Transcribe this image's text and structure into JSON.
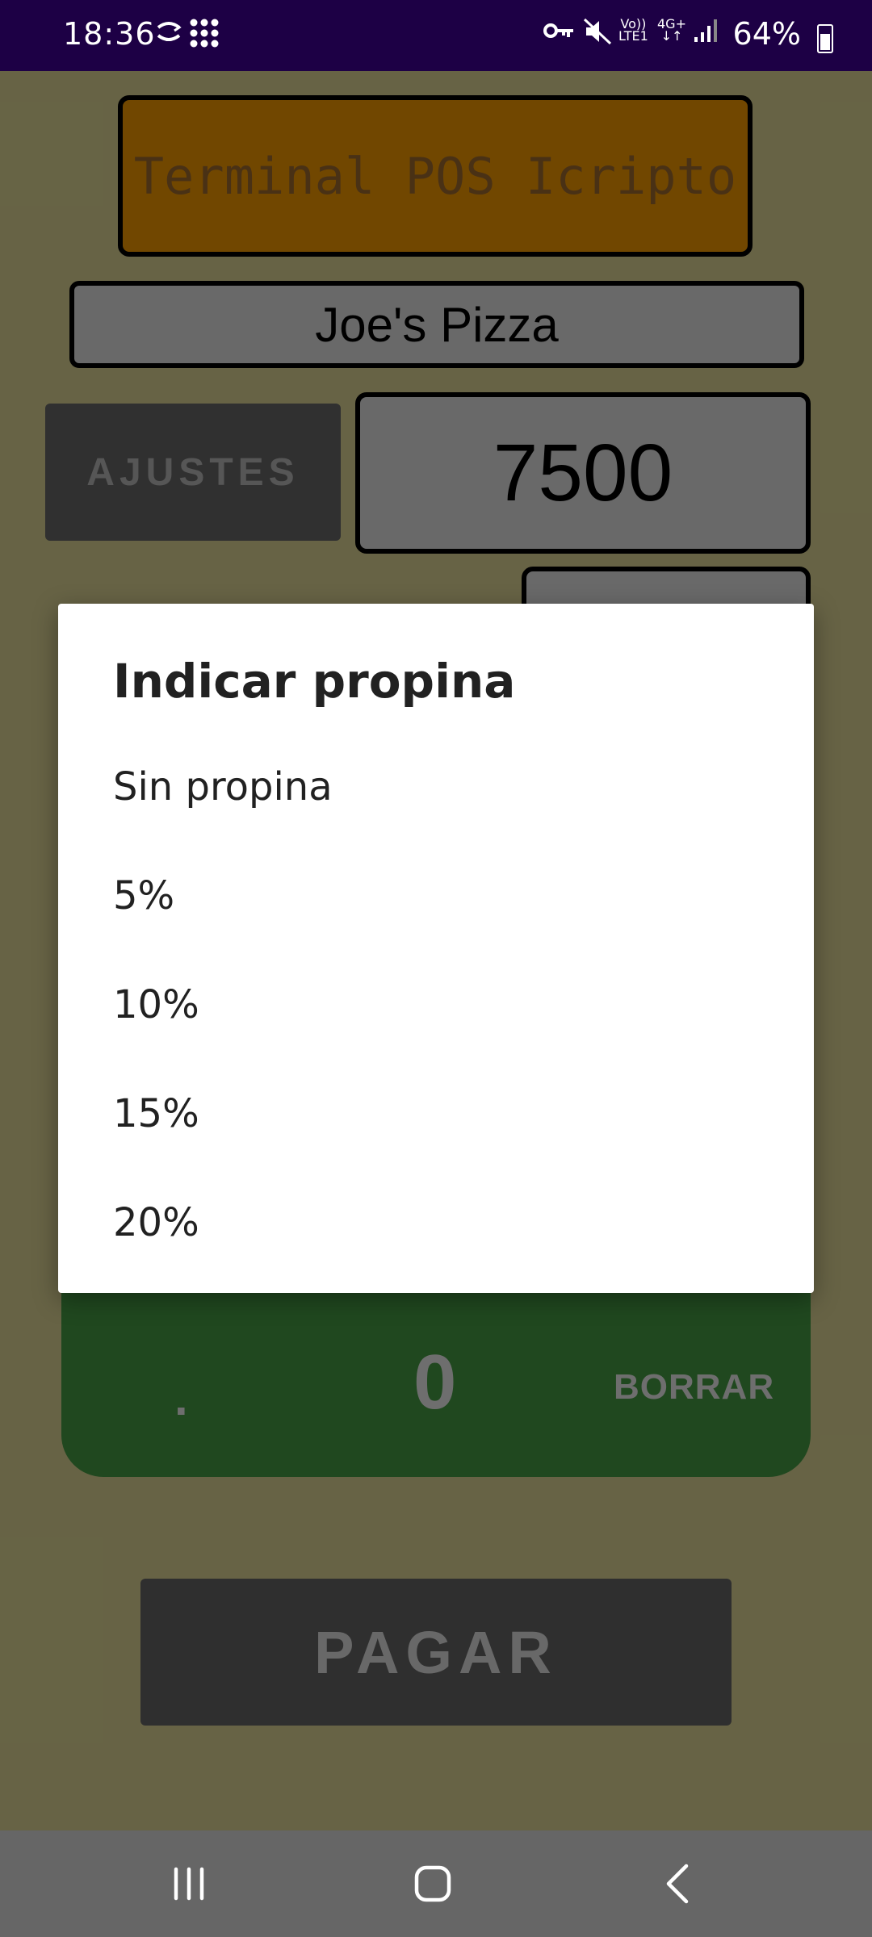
{
  "status_bar": {
    "time": "18:36",
    "battery": "64%",
    "icons": [
      "sync-icon",
      "apps-grid-icon",
      "vpn-key-icon",
      "mute-icon",
      "volte-icon",
      "4g-icon",
      "signal-icon",
      "battery-icon"
    ]
  },
  "app": {
    "title": "Terminal POS Icripto",
    "store_name": "Joe's Pizza",
    "settings_label": "AJUSTES",
    "amount": "7500",
    "keypad": {
      "dot": ".",
      "zero": "0",
      "clear": "BORRAR"
    },
    "pay_label": "PAGAR"
  },
  "dialog": {
    "title": "Indicar propina",
    "options": [
      "Sin propina",
      "5%",
      "10%",
      "15%",
      "20%"
    ]
  },
  "nav_bar": {
    "icons": [
      "recent-apps-icon",
      "home-icon",
      "back-icon"
    ]
  },
  "colors": {
    "status_bar": "#1d0045",
    "background": "#c6bf85",
    "title_bg": "#d98800",
    "keypad_bg": "#3f8a3c",
    "button_bg": "#5c5c5c",
    "nav_bar": "#666666"
  }
}
